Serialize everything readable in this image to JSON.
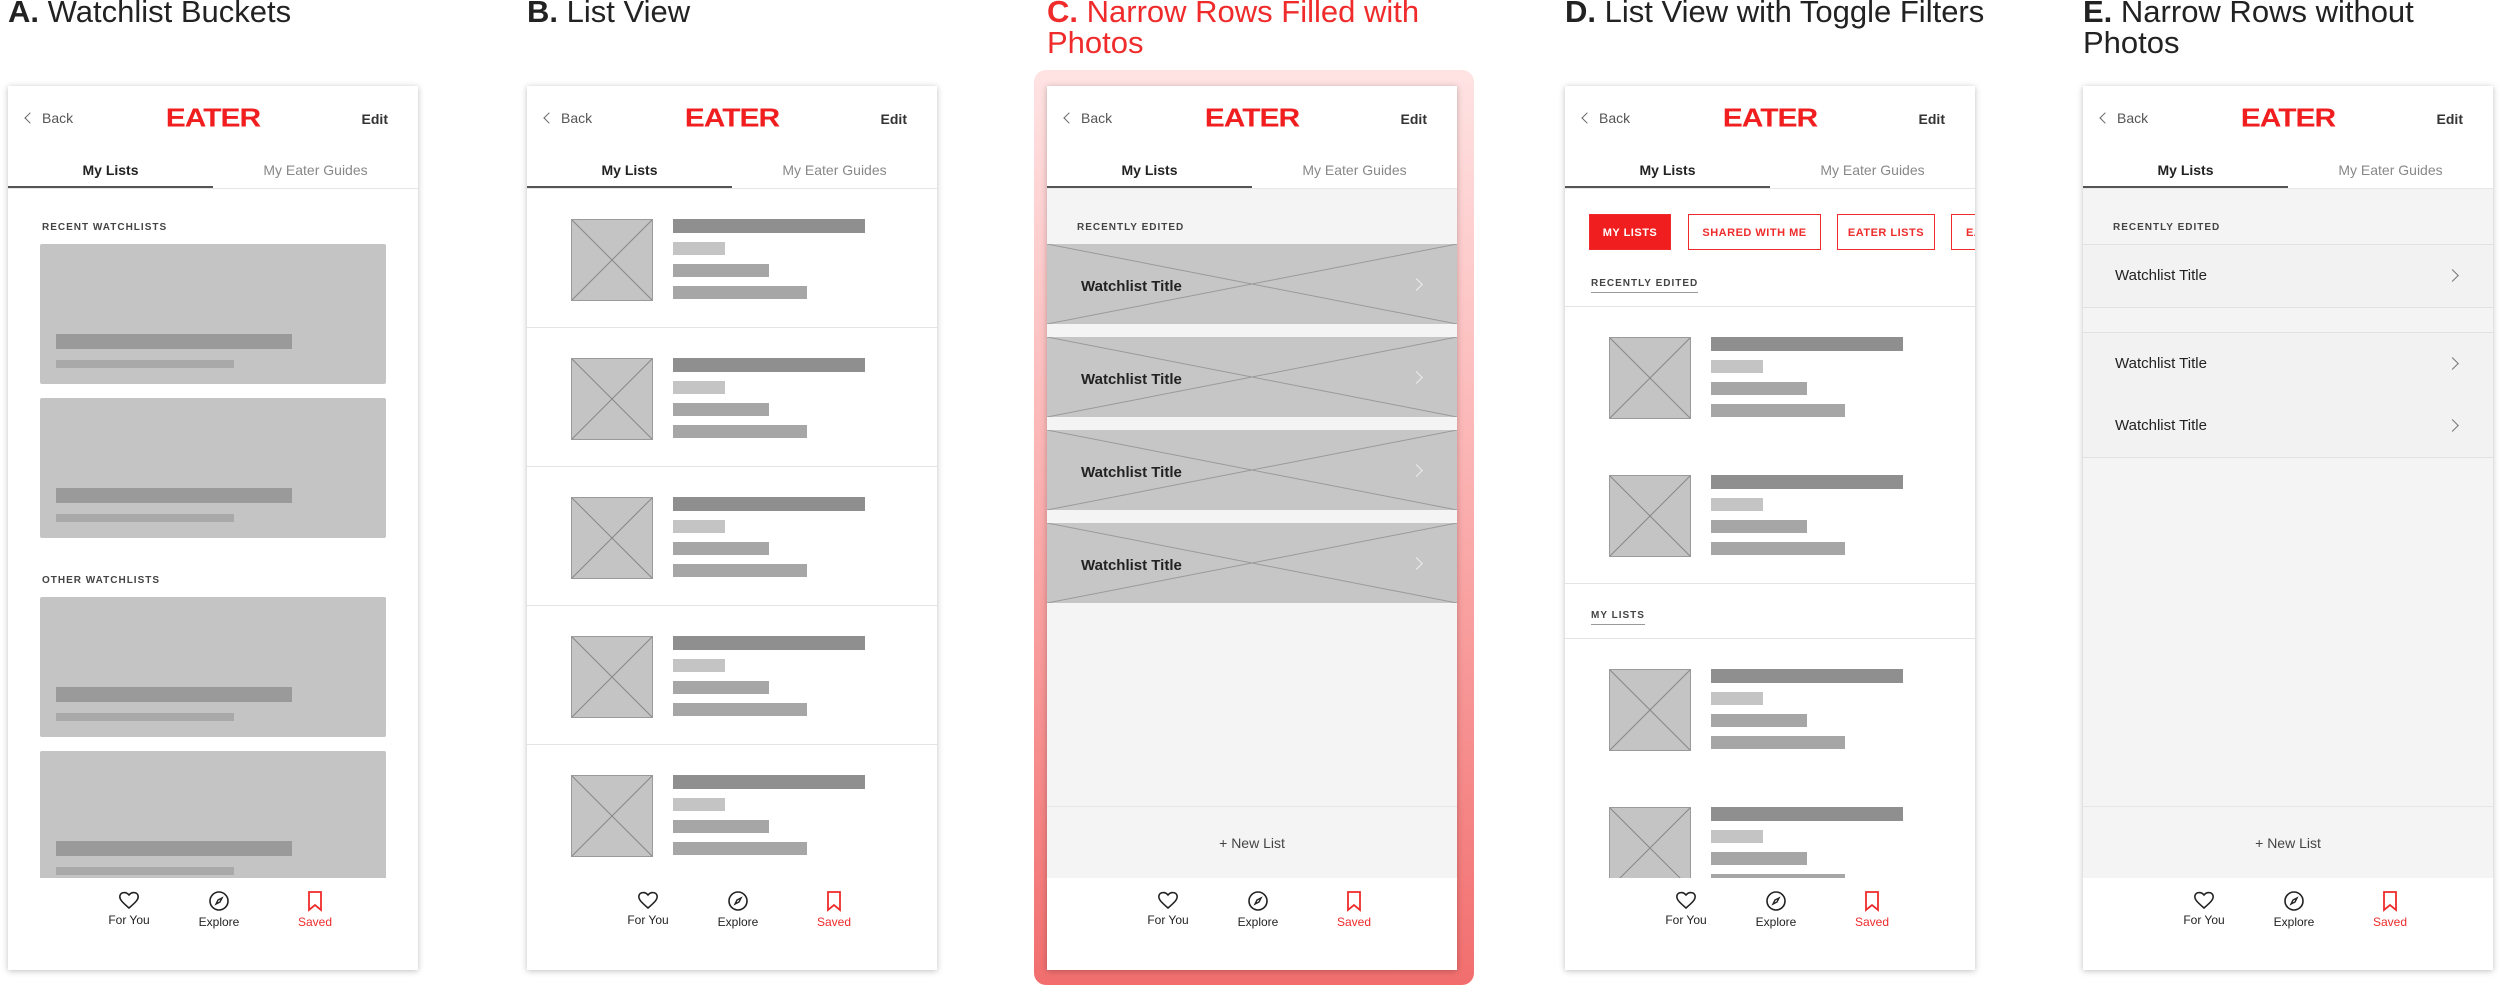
{
  "panels": [
    {
      "letter": "A.",
      "title": "Watchlist Buckets"
    },
    {
      "letter": "B.",
      "title": "List View"
    },
    {
      "letter": "C.",
      "title": "Narrow Rows Filled with Photos"
    },
    {
      "letter": "D.",
      "title": "List View with Toggle Filters"
    },
    {
      "letter": "E.",
      "title": "Narrow Rows without Photos"
    }
  ],
  "header": {
    "back_label": "Back",
    "logo_text": "EATER",
    "edit_label": "Edit"
  },
  "tabs": {
    "my_lists": "My Lists",
    "my_guides": "My Eater Guides"
  },
  "nav": {
    "for_you": "For You",
    "explore": "Explore",
    "saved": "Saved"
  },
  "new_list_label": "New List",
  "panel_a": {
    "recent_label": "RECENT WATCHLISTS",
    "other_label": "OTHER WATCHLISTS"
  },
  "panel_c": {
    "section_label": "RECENTLY EDITED",
    "rows": [
      "Watchlist Title",
      "Watchlist Title",
      "Watchlist Title",
      "Watchlist Title"
    ]
  },
  "panel_d": {
    "filters": [
      "MY LISTS",
      "SHARED WITH ME",
      "EATER LISTS",
      "EA"
    ],
    "recently_edited_label": "RECENTLY EDITED",
    "my_lists_label": "MY LISTS"
  },
  "panel_e": {
    "section_label": "RECENTLY EDITED",
    "rows": [
      "Watchlist Title",
      "Watchlist Title",
      "Watchlist Title"
    ]
  },
  "colors": {
    "accent": "#f01e1e",
    "placeholder": "#c4c4c4",
    "glow_top": "#ffe3e3",
    "glow_bottom": "#f26e6e"
  },
  "icons": {
    "back": "chevron-left-icon",
    "for_you": "heart-icon",
    "explore": "compass-icon",
    "saved": "bookmark-icon",
    "row": "chevron-right-icon",
    "new": "plus-icon"
  }
}
